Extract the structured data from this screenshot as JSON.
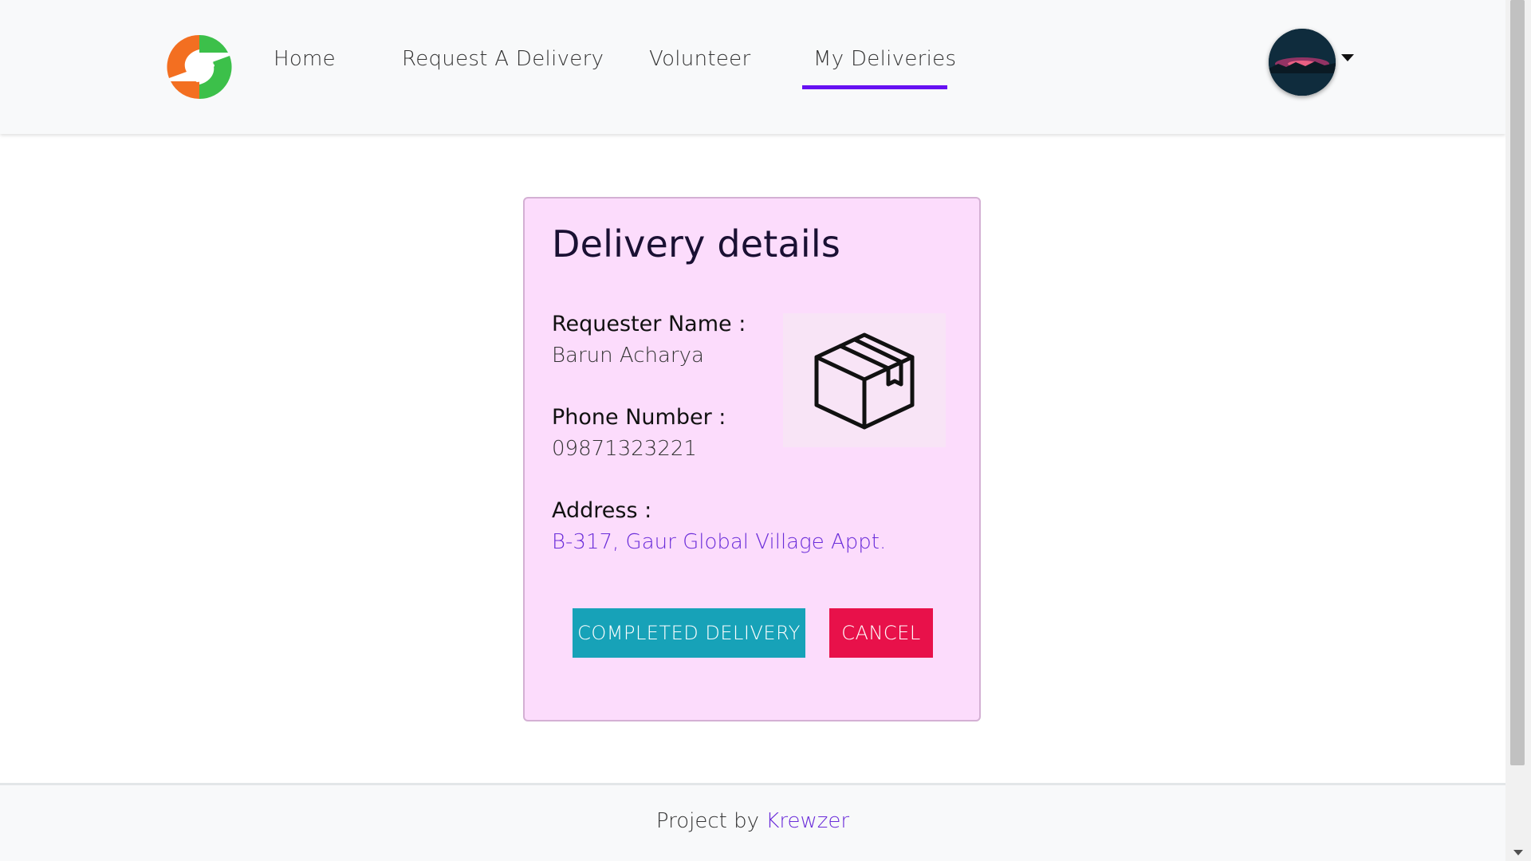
{
  "nav": {
    "logo_icon": "helping-hands-logo",
    "links": [
      {
        "label": "Home"
      },
      {
        "label": "Request A Delivery"
      },
      {
        "label": "Volunteer"
      },
      {
        "label": "My Deliveries"
      }
    ],
    "active_index": 3,
    "accent_color": "#6610f2"
  },
  "user_menu": {
    "avatar_icon": "user-avatar",
    "dropdown_icon": "caret-down-icon"
  },
  "card": {
    "title": "Delivery details",
    "fields": {
      "requester_label": "Requester Name :",
      "requester_value": "Barun Acharya",
      "phone_label": "Phone Number :",
      "phone_value": "09871323221",
      "address_label": "Address :",
      "address_value": "B-317, Gaur Global Village Appt."
    },
    "image_icon": "package-box-icon",
    "background_color": "#fcdcfc",
    "buttons": {
      "complete_label": "COMPLETED DELIVERY",
      "complete_color": "#17a2b8",
      "cancel_label": "CANCEL",
      "cancel_color": "#e8114a"
    }
  },
  "footer": {
    "prefix": "Project by",
    "link_label": "Krewzer"
  }
}
